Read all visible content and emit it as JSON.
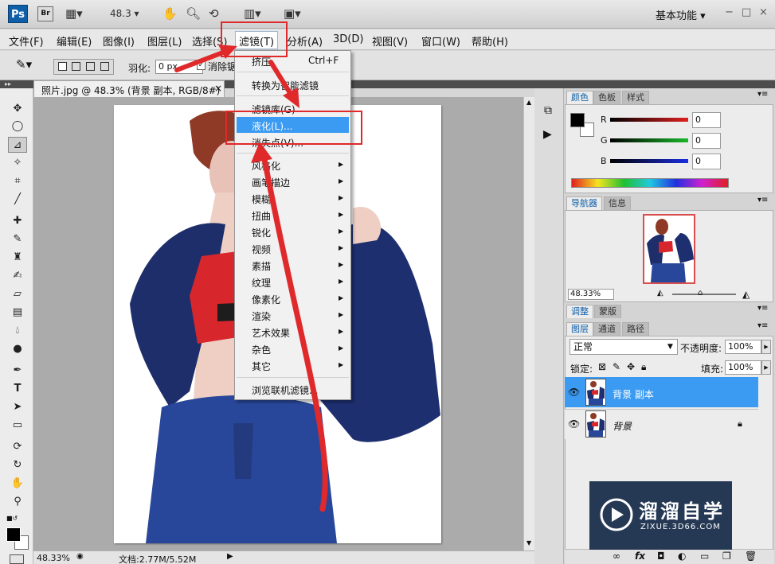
{
  "app": {
    "logo": "Ps",
    "bridge": "Br",
    "zoom": "48.3",
    "workspace": "基本功能",
    "window_controls": [
      "−",
      "□",
      "×"
    ]
  },
  "menubar": {
    "items": [
      "文件(F)",
      "编辑(E)",
      "图像(I)",
      "图层(L)",
      "选择(S)",
      "滤镜(T)",
      "分析(A)",
      "3D(D)",
      "视图(V)",
      "窗口(W)",
      "帮助(H)"
    ]
  },
  "options": {
    "feather_label": "羽化:",
    "feather_value": "0 px",
    "antialias_label": "消除锯齿"
  },
  "document": {
    "tab_title": "照片.jpg @ 48.3% (背景 副本, RGB/8#) *",
    "zoom": "48.33%",
    "doc_info": "文档:2.77M/5.52M"
  },
  "filter_menu": {
    "last_filter": "挤压",
    "last_filter_shortcut": "Ctrl+F",
    "convert_smart": "转换为智能滤镜",
    "gallery": "滤镜库(G)",
    "liquify": "液化(L)...",
    "vanishing": "消失点(V)...",
    "submenus": [
      "风格化",
      "画笔描边",
      "模糊",
      "扭曲",
      "锐化",
      "视频",
      "素描",
      "纹理",
      "像素化",
      "渲染",
      "艺术效果",
      "杂色",
      "其它"
    ],
    "browse": "浏览联机滤镜..."
  },
  "color_panel": {
    "tabs": [
      "颜色",
      "色板",
      "样式"
    ],
    "channels": [
      {
        "label": "R",
        "value": "0",
        "color": "#e02020"
      },
      {
        "label": "G",
        "value": "0",
        "color": "#19b82a"
      },
      {
        "label": "B",
        "value": "0",
        "color": "#1b2ee0"
      }
    ]
  },
  "navigator": {
    "tabs": [
      "导航器",
      "信息"
    ],
    "zoom": "48.33%"
  },
  "adjust_tabs": [
    "调整",
    "蒙版"
  ],
  "layers_panel": {
    "tabs": [
      "图层",
      "通道",
      "路径"
    ],
    "blend_mode": "正常",
    "opacity_label": "不透明度:",
    "opacity": "100%",
    "lock_label": "锁定:",
    "fill_label": "填充:",
    "fill": "100%",
    "layers": [
      {
        "name": "背景 副本",
        "selected": true
      },
      {
        "name": "背景",
        "selected": false
      }
    ]
  },
  "watermark": {
    "brand": "溜溜自学",
    "url": "ZIXUE.3D66.COM"
  },
  "colors": {
    "accent": "#3b9bf2",
    "annotation": "#e0292b",
    "ps_blue": "#0f5fa8"
  }
}
